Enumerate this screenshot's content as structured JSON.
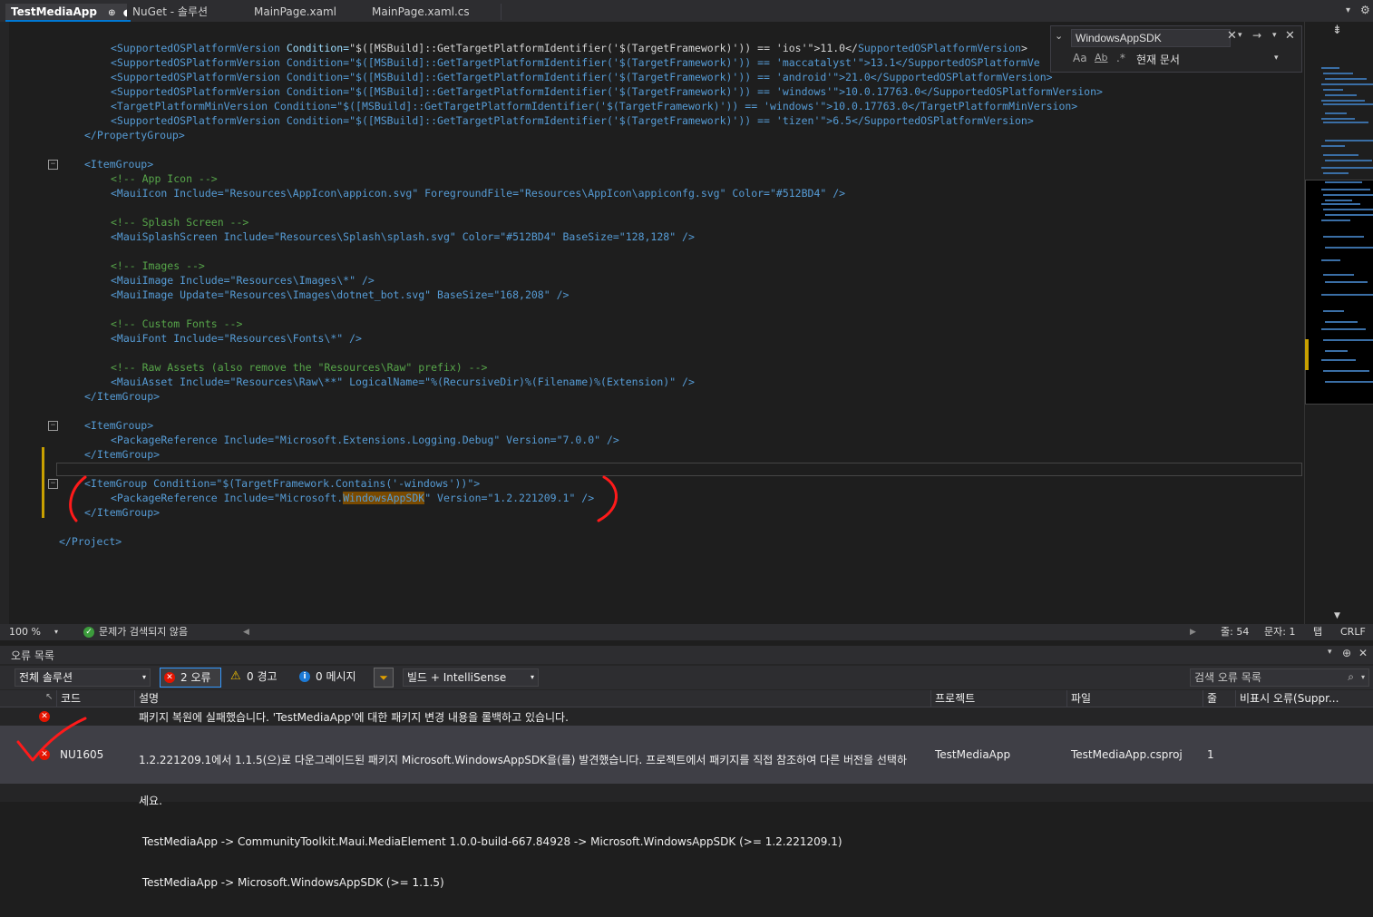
{
  "tabs": [
    {
      "label": "TestMediaApp",
      "pin": "⊕",
      "dot": "●",
      "active": true
    },
    {
      "label": "NuGet - 솔루션",
      "active": false
    },
    {
      "label": "MainPage.xaml",
      "active": false
    },
    {
      "label": "MainPage.xaml.cs",
      "active": false
    }
  ],
  "find": {
    "query": "WindowsAppSDK",
    "scope": "현재 문서",
    "opt_case": "Aa",
    "opt_word": "Ab",
    "opt_regex": ".*"
  },
  "code": {
    "l1a": "<SupportedOSPlatformVersion",
    "l1b": " Condition=",
    "l1c": "\"$([MSBuild]::GetTargetPlatformIdentifier('$(TargetFramework)')) == 'ios'\"",
    "l1d": ">11.0</",
    "l1e": "SupportedOSPlatformVersion",
    "l1f": ">",
    "l2": "<SupportedOSPlatformVersion Condition=\"$([MSBuild]::GetTargetPlatformIdentifier('$(TargetFramework)')) == 'maccatalyst'\">13.1</SupportedOSPlatformVe",
    "l3": "<SupportedOSPlatformVersion Condition=\"$([MSBuild]::GetTargetPlatformIdentifier('$(TargetFramework)')) == 'android'\">21.0</SupportedOSPlatformVersion>",
    "l4": "<SupportedOSPlatformVersion Condition=\"$([MSBuild]::GetTargetPlatformIdentifier('$(TargetFramework)')) == 'windows'\">10.0.17763.0</SupportedOSPlatformVersion>",
    "l5": "<TargetPlatformMinVersion Condition=\"$([MSBuild]::GetTargetPlatformIdentifier('$(TargetFramework)')) == 'windows'\">10.0.17763.0</TargetPlatformMinVersion>",
    "l6": "<SupportedOSPlatformVersion Condition=\"$([MSBuild]::GetTargetPlatformIdentifier('$(TargetFramework)')) == 'tizen'\">6.5</SupportedOSPlatformVersion>",
    "l7": "</PropertyGroup>",
    "l8": "<ItemGroup>",
    "l9": "<!-- App Icon -->",
    "l10": "<MauiIcon Include=\"Resources\\AppIcon\\appicon.svg\" ForegroundFile=\"Resources\\AppIcon\\appiconfg.svg\" Color=\"#512BD4\" />",
    "l11": "<!-- Splash Screen -->",
    "l12": "<MauiSplashScreen Include=\"Resources\\Splash\\splash.svg\" Color=\"#512BD4\" BaseSize=\"128,128\" />",
    "l13": "<!-- Images -->",
    "l14": "<MauiImage Include=\"Resources\\Images\\*\" />",
    "l15": "<MauiImage Update=\"Resources\\Images\\dotnet_bot.svg\" BaseSize=\"168,208\" />",
    "l16": "<!-- Custom Fonts -->",
    "l17": "<MauiFont Include=\"Resources\\Fonts\\*\" />",
    "l18": "<!-- Raw Assets (also remove the \"Resources\\Raw\" prefix) -->",
    "l19": "<MauiAsset Include=\"Resources\\Raw\\**\" LogicalName=\"%(RecursiveDir)%(Filename)%(Extension)\" />",
    "l20": "</ItemGroup>",
    "l21": "<ItemGroup>",
    "l22": "<PackageReference Include=\"Microsoft.Extensions.Logging.Debug\" Version=\"7.0.0\" />",
    "l23": "</ItemGroup>",
    "l24": "<ItemGroup Condition=\"$(TargetFramework.Contains('-windows'))\">",
    "l25a": "<PackageReference Include=\"Microsoft.",
    "l25b": "WindowsAppSDK",
    "l25c": "\" Version=\"1.2.221209.1\" />",
    "l26": "</ItemGroup>",
    "l27": "</Project>"
  },
  "editor_status": {
    "zoom": "100 %",
    "issues": "문제가 검색되지 않음",
    "line": "줄: 54",
    "char": "문자: 1",
    "tab": "탭",
    "eol": "CRLF"
  },
  "error_list": {
    "title": "오류 목록",
    "scope": "전체 솔루션",
    "errors_btn": "2 오류",
    "warnings_btn": "0 경고",
    "messages_btn": "0 메시지",
    "build_filter": "빌드 + IntelliSense",
    "search_placeholder": "검색 오류 목록",
    "columns": {
      "code": "코드",
      "desc": "설명",
      "project": "프로젝트",
      "file": "파일",
      "line": "줄",
      "suppress": "비표시 오류(Suppr..."
    },
    "rows": [
      {
        "code": "",
        "desc": "패키지 복원에 실패했습니다. 'TestMediaApp'에 대한 패키지 변경 내용을 롤백하고 있습니다.",
        "project": "",
        "file": "",
        "line": ""
      },
      {
        "code": "NU1605",
        "desc1": "1.2.221209.1에서 1.1.5(으)로 다운그레이드된 패키지 Microsoft.WindowsAppSDK을(를) 발견했습니다. 프로젝트에서 패키지를 직접 참조하여 다른 버전을 선택하",
        "desc2": "세요.",
        "desc3": " TestMediaApp -> CommunityToolkit.Maui.MediaElement 1.0.0-build-667.84928 -> Microsoft.WindowsAppSDK (>= 1.2.221209.1)",
        "desc4": " TestMediaApp -> Microsoft.WindowsAppSDK (>= 1.1.5)",
        "project": "TestMediaApp",
        "file": "TestMediaApp.csproj",
        "line": "1"
      }
    ]
  },
  "colors": {
    "accent": "#0078d4",
    "error": "#e51400",
    "annotation": "#ff1a1a",
    "xml_tag": "#569cd6",
    "comment": "#57a64a"
  }
}
